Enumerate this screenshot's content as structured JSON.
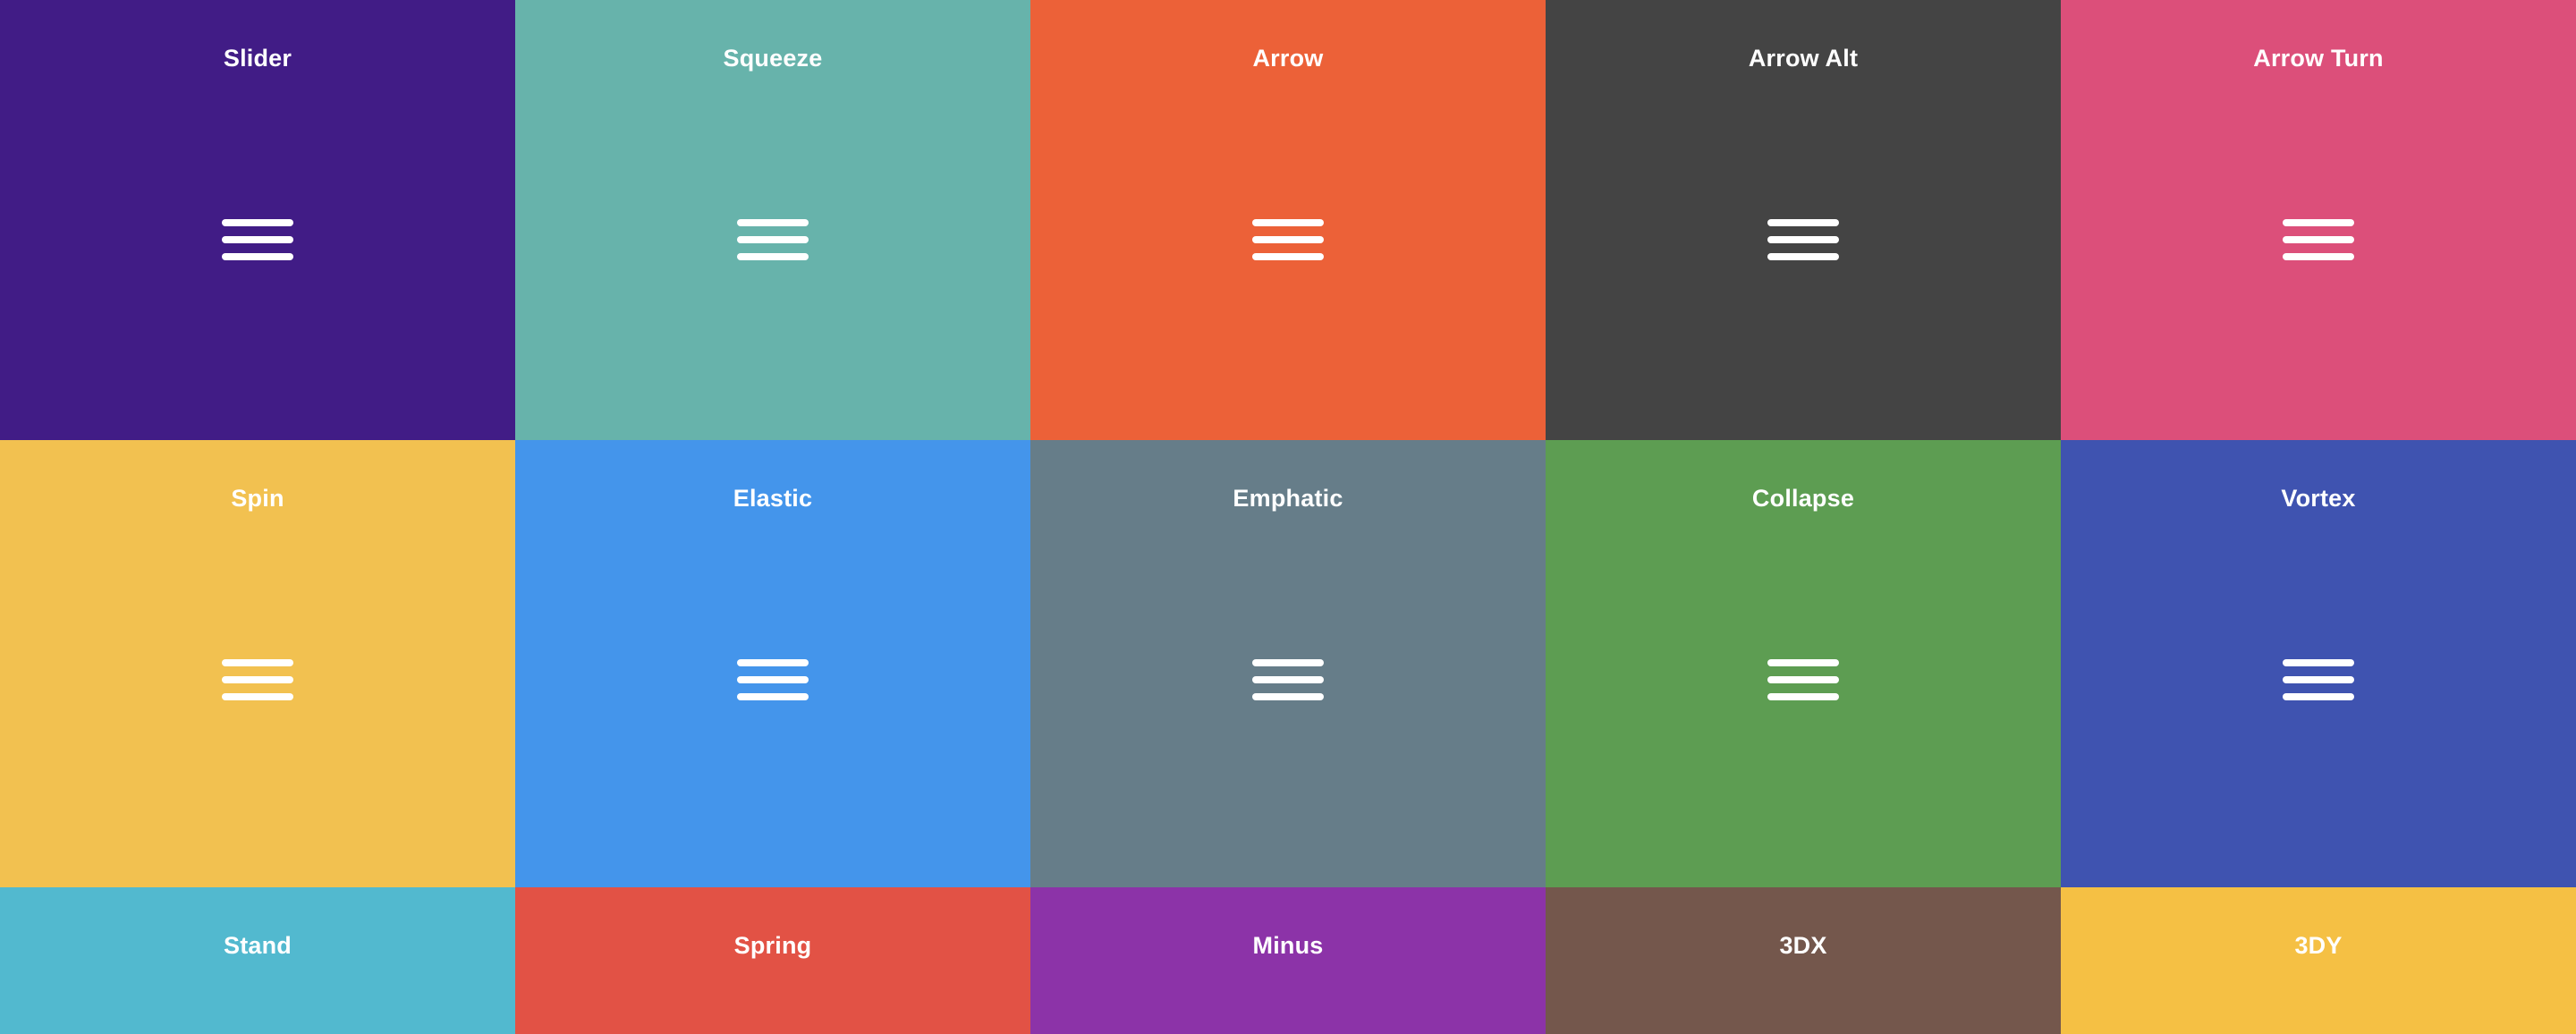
{
  "tiles": [
    {
      "label": "Slider",
      "color": "#411C86",
      "icon": "hamburger-icon"
    },
    {
      "label": "Squeeze",
      "color": "#67B3AB",
      "icon": "hamburger-icon"
    },
    {
      "label": "Arrow",
      "color": "#EC6138",
      "icon": "hamburger-icon"
    },
    {
      "label": "Arrow Alt",
      "color": "#444444",
      "icon": "hamburger-icon"
    },
    {
      "label": "Arrow Turn",
      "color": "#DC4F7A",
      "icon": "hamburger-icon"
    },
    {
      "label": "Spin",
      "color": "#F2C150",
      "icon": "hamburger-icon"
    },
    {
      "label": "Elastic",
      "color": "#4495EB",
      "icon": "hamburger-icon"
    },
    {
      "label": "Emphatic",
      "color": "#667D89",
      "icon": "hamburger-icon"
    },
    {
      "label": "Collapse",
      "color": "#5D9D52",
      "icon": "hamburger-icon"
    },
    {
      "label": "Vortex",
      "color": "#3F53B0",
      "icon": "hamburger-icon"
    },
    {
      "label": "Stand",
      "color": "#52B9CF",
      "icon": "hamburger-icon"
    },
    {
      "label": "Spring",
      "color": "#E25245",
      "icon": "hamburger-icon"
    },
    {
      "label": "Minus",
      "color": "#8C33A8",
      "icon": "hamburger-icon"
    },
    {
      "label": "3DX",
      "color": "#74574C",
      "icon": "hamburger-icon"
    },
    {
      "label": "3DY",
      "color": "#F5C044",
      "icon": "hamburger-icon"
    }
  ]
}
